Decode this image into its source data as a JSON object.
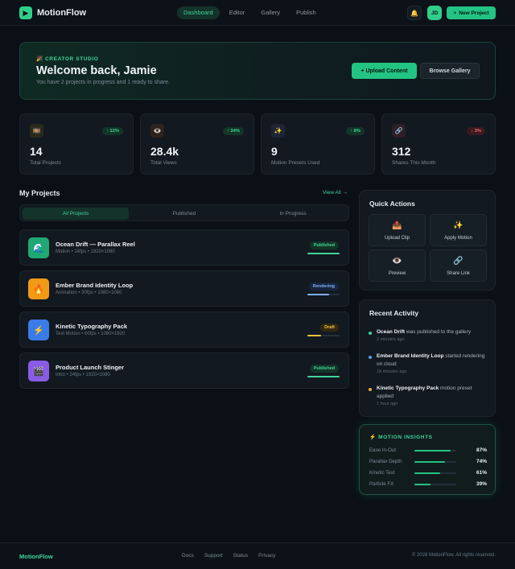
{
  "app": {
    "logo_icon": "▶",
    "name": "MotionFlow",
    "nav": [
      {
        "label": "Dashboard",
        "active": true
      },
      {
        "label": "Editor"
      },
      {
        "label": "Gallery"
      },
      {
        "label": "Publish"
      }
    ],
    "bell_icon": "🔔",
    "avatar_initials": "JD",
    "new_project_label": "New Project"
  },
  "hero": {
    "eyebrow": "🎉 CREATOR STUDIO",
    "title": "Welcome back, Jamie",
    "subtitle": "You have 2 projects in progress and 1 ready to share.",
    "upload_label": "+ Upload Content",
    "browse_label": "Browse Gallery"
  },
  "stats": [
    {
      "icon": "🎞️",
      "delta": "↑ 12%",
      "trend": "up",
      "value": "14",
      "label": "Total Projects"
    },
    {
      "icon": "👁️",
      "delta": "↑ 34%",
      "trend": "up",
      "value": "28.4k",
      "label": "Total Views"
    },
    {
      "icon": "✨",
      "delta": "↑ 8%",
      "trend": "up",
      "value": "9",
      "label": "Motion Presets Used"
    },
    {
      "icon": "🔗",
      "delta": "↓ 3%",
      "trend": "down",
      "value": "312",
      "label": "Shares This Month"
    }
  ],
  "projects": {
    "title": "My Projects",
    "view_all": "View All →",
    "filters": [
      {
        "label": "All Projects",
        "active": true
      },
      {
        "label": "Published"
      },
      {
        "label": "In Progress"
      }
    ],
    "items": [
      {
        "icon": "🌊",
        "name": "Ocean Drift — Parallax Reel",
        "meta": "Motion • 24fps • 1920×1080",
        "status": "Published",
        "progress": 1.0,
        "status_color": "#3fd49a",
        "status_bg": "#133527",
        "thumb_color": "#1fa874"
      },
      {
        "icon": "🔥",
        "name": "Ember Brand Identity Loop",
        "meta": "Animation • 30fps • 1080×1080",
        "status": "Rendering",
        "progress": 0.68,
        "status_color": "#7fb0f5",
        "status_bg": "#17263d",
        "thumb_color": "#f29a16"
      },
      {
        "icon": "⚡",
        "name": "Kinetic Typography Pack",
        "meta": "Text Motion • 60fps • 1080×1920",
        "status": "Draft",
        "progress": 0.42,
        "status_color": "#f2c13a",
        "status_bg": "#33290f",
        "thumb_color": "#3b7be8"
      },
      {
        "icon": "🎬",
        "name": "Product Launch Stinger",
        "meta": "Intro • 24fps • 1920×1080",
        "status": "Published",
        "progress": 1.0,
        "status_color": "#3fd49a",
        "status_bg": "#133527",
        "thumb_color": "#8a5ce6"
      }
    ]
  },
  "quick_actions": {
    "title": "Quick Actions",
    "items": [
      {
        "icon": "📤",
        "label": "Upload Clip"
      },
      {
        "icon": "✨",
        "label": "Apply Motion"
      },
      {
        "icon": "👁️",
        "label": "Preview"
      },
      {
        "icon": "🔗",
        "label": "Share Link"
      }
    ]
  },
  "activity": {
    "title": "Recent Activity",
    "items": [
      {
        "subject": "Ocean Drift",
        "text": " was published to the gallery",
        "time": "2 minutes ago",
        "dot": "#3fd49a"
      },
      {
        "subject": "Ember Brand Identity Loop",
        "text": " started rendering on cloud",
        "time": "18 minutes ago",
        "dot": "#5b9cf0"
      },
      {
        "subject": "Kinetic Typography Pack",
        "text": " motion preset applied",
        "time": "1 hour ago",
        "dot": "#f2a93a"
      }
    ]
  },
  "insights": {
    "title": "⚡ MOTION INSIGHTS",
    "items": [
      {
        "label": "Ease In-Out",
        "value": "87%",
        "fraction": 0.87
      },
      {
        "label": "Parallax Depth",
        "value": "74%",
        "fraction": 0.74
      },
      {
        "label": "Kinetic Text",
        "value": "61%",
        "fraction": 0.61
      },
      {
        "label": "Particle FX",
        "value": "39%",
        "fraction": 0.39
      }
    ]
  },
  "footer": {
    "logo": "MotionFlow",
    "links": [
      "Docs",
      "Support",
      "Status",
      "Privacy"
    ],
    "copyright": "© 2026 MotionFlow. All rights reserved."
  }
}
